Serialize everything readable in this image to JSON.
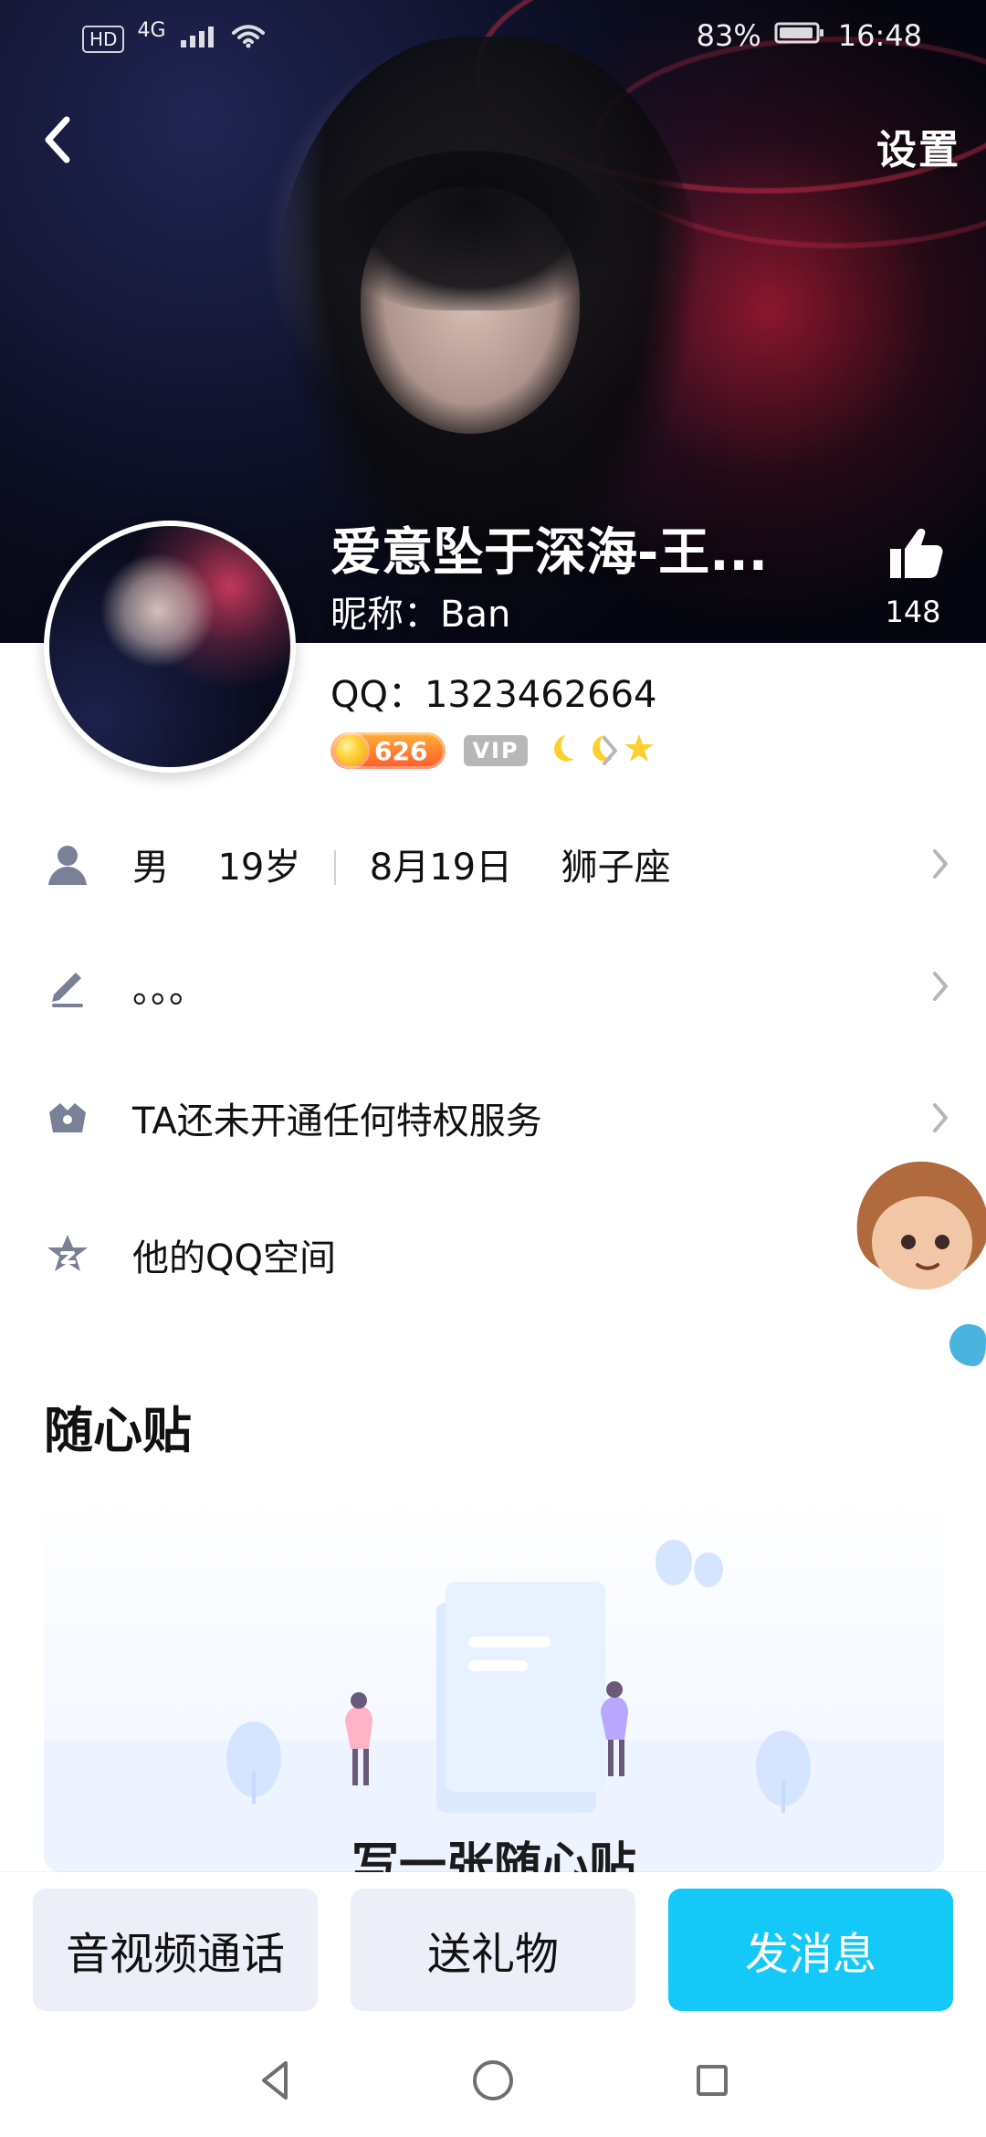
{
  "status_bar": {
    "left": [
      "HD",
      "4G"
    ],
    "battery": "83%",
    "time": "16:48"
  },
  "header": {
    "back_icon": "chevron-left-icon",
    "settings_label": "设置",
    "name": "爱意坠于深海-王...",
    "nickname_label": "昵称：",
    "nickname_value": "Ban",
    "likes_count": "148",
    "like_icon": "thumbs-up-icon"
  },
  "profile": {
    "qq_label": "QQ：",
    "qq_number": "1323462664",
    "level_value": "626",
    "vip_label": "VIP"
  },
  "rows": [
    {
      "icon": "user-icon",
      "text_parts": [
        "男",
        "19岁",
        "8月19日",
        "狮子座"
      ]
    },
    {
      "icon": "edit-icon",
      "text": "。。。"
    },
    {
      "icon": "crown-icon",
      "text": "TA还未开通任何特权服务"
    },
    {
      "icon": "qzone-icon",
      "text": "他的QQ空间"
    }
  ],
  "section": {
    "title": "随心贴",
    "card_cta": "写一张随心贴"
  },
  "bottom_actions": {
    "call": "音视频通话",
    "gift": "送礼物",
    "message": "发消息"
  },
  "nav": {
    "back": "nav-back-icon",
    "home": "nav-home-icon",
    "recent": "nav-recent-icon"
  },
  "colors": {
    "primary": "#14c8f7",
    "button_gray": "#eceff7"
  }
}
